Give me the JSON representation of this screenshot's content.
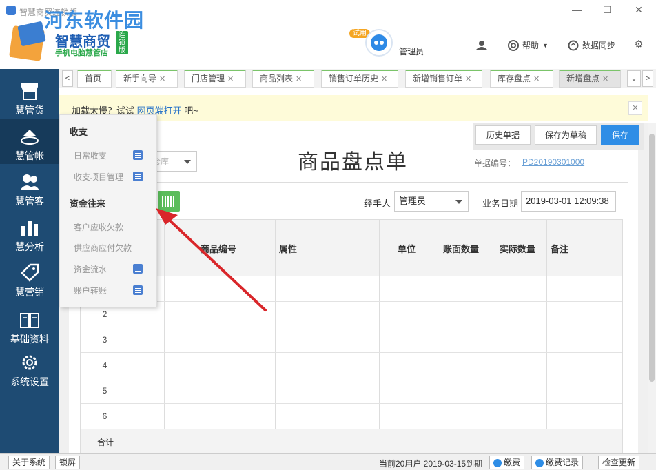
{
  "app": {
    "title": "智慧商贸连锁版",
    "watermark": "河东软件园",
    "brand_name": "智慧商贸",
    "brand_tag": "连锁版",
    "brand_sub": "手机电脑慧管店",
    "trial_badge": "试用",
    "user_name": "管理员",
    "help_label": "帮助",
    "sync_label": "数据同步"
  },
  "sidebar": {
    "items": [
      {
        "label": "慧管货",
        "icon": "store-icon"
      },
      {
        "label": "慧管帐",
        "icon": "ledger-icon"
      },
      {
        "label": "慧管客",
        "icon": "customers-icon"
      },
      {
        "label": "慧分析",
        "icon": "bar-chart-icon"
      },
      {
        "label": "慧营销",
        "icon": "tag-icon"
      },
      {
        "label": "基础资料",
        "icon": "book-icon"
      },
      {
        "label": "系统设置",
        "icon": "gear-icon"
      }
    ]
  },
  "tabs": [
    {
      "label": "首页",
      "closable": false
    },
    {
      "label": "新手向导",
      "closable": true
    },
    {
      "label": "门店管理",
      "closable": true
    },
    {
      "label": "商品列表",
      "closable": true
    },
    {
      "label": "销售订单历史",
      "closable": true
    },
    {
      "label": "新增销售订单",
      "closable": true
    },
    {
      "label": "库存盘点",
      "closable": true
    },
    {
      "label": "新增盘点",
      "closable": true,
      "active": true
    }
  ],
  "notice": {
    "prefix": "加载太慢？试试 ",
    "link": "网页端打开",
    "suffix": " 吧~"
  },
  "toolbar": {
    "history_label": "历史单据",
    "draft_label": "保存为草稿",
    "save_label": "保存"
  },
  "doc": {
    "title": "商品盘点单",
    "no_label": "单据编号：",
    "no": "PD20190301000",
    "warehouse_placeholder": "仓库",
    "handler_label": "经手人",
    "handler": "管理员",
    "date_label": "业务日期",
    "date": "2019-03-01 12:09:38"
  },
  "table": {
    "columns": [
      "商品编号",
      "属性",
      "单位",
      "账面数量",
      "实际数量",
      "备注"
    ],
    "row_numbers": [
      "1",
      "2",
      "3",
      "4",
      "5",
      "6"
    ],
    "total_label": "合计"
  },
  "menu": {
    "section1": "收支",
    "section1_items": [
      "日常收支",
      "收支项目管理"
    ],
    "section2": "资金往来",
    "section2_items": [
      "客户应收欠款",
      "供应商应付欠款",
      "资金流水",
      "账户转账"
    ]
  },
  "status": {
    "about": "关于系统",
    "lock": "锁屏",
    "users_info": "当前20用户 2019-03-15到期",
    "pay": "缴费",
    "pay_history": "缴费记录",
    "check_update": "检查更新"
  },
  "colors": {
    "sidebar": "#1e4b73",
    "primary": "#2e8de6",
    "tab_accent": "#7bc46a",
    "arrow": "#d9262a"
  }
}
